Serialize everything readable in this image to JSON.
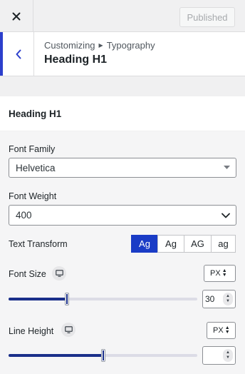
{
  "topbar": {
    "close_icon": "close-icon",
    "publish_label": "Published"
  },
  "header": {
    "back_icon": "chevron-left-icon",
    "breadcrumb_root": "Customizing",
    "breadcrumb_current": "Typography",
    "title": "Heading H1"
  },
  "section": {
    "heading": "Heading H1"
  },
  "font_family": {
    "label": "Font Family",
    "value": "Helvetica"
  },
  "font_weight": {
    "label": "Font Weight",
    "value": "400"
  },
  "text_transform": {
    "label": "Text Transform",
    "options": [
      "Ag",
      "Ag",
      "AG",
      "ag"
    ],
    "selected_index": 0
  },
  "font_size": {
    "label": "Font Size",
    "unit": "PX",
    "value": "30",
    "slider_fraction": 0.31,
    "device_icon": "desktop-icon"
  },
  "line_height": {
    "label": "Line Height",
    "unit": "PX",
    "value": "",
    "slider_fraction": 0.5,
    "device_icon": "desktop-icon"
  },
  "colors": {
    "accent": "#1a3cc6",
    "slider_fill": "#1a2f8a",
    "back_border": "#2c3fcc"
  }
}
